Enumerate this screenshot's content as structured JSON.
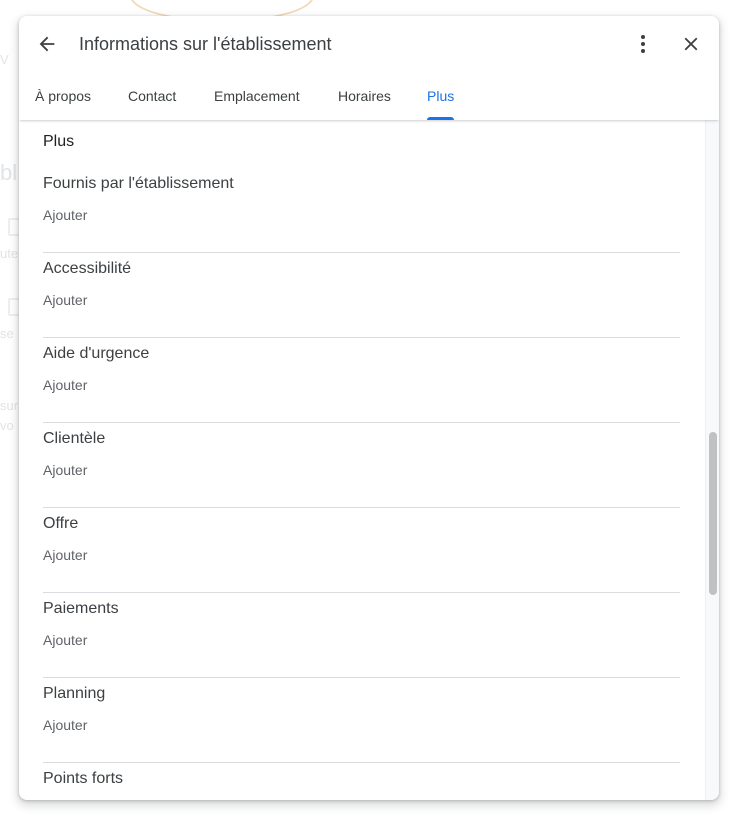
{
  "dialog": {
    "title": "Informations sur l'établissement",
    "back_icon": "arrow-back-icon",
    "more_icon": "more-vert-icon",
    "close_icon": "close-icon"
  },
  "tabs": [
    {
      "label": "À propos",
      "active": false
    },
    {
      "label": "Contact",
      "active": false
    },
    {
      "label": "Emplacement",
      "active": false
    },
    {
      "label": "Horaires",
      "active": false
    },
    {
      "label": "Plus",
      "active": true
    }
  ],
  "section": {
    "title": "Plus",
    "items": [
      {
        "label": "Fournis par l'établissement",
        "action": "Ajouter"
      },
      {
        "label": "Accessibilité",
        "action": "Ajouter"
      },
      {
        "label": "Aide d'urgence",
        "action": "Ajouter"
      },
      {
        "label": "Clientèle",
        "action": "Ajouter"
      },
      {
        "label": "Offre",
        "action": "Ajouter"
      },
      {
        "label": "Paiements",
        "action": "Ajouter"
      },
      {
        "label": "Planning",
        "action": "Ajouter"
      },
      {
        "label": "Points forts",
        "action": ""
      }
    ]
  },
  "scrollbar": {
    "position_fraction": 0.6,
    "visible_fraction": 0.24
  }
}
